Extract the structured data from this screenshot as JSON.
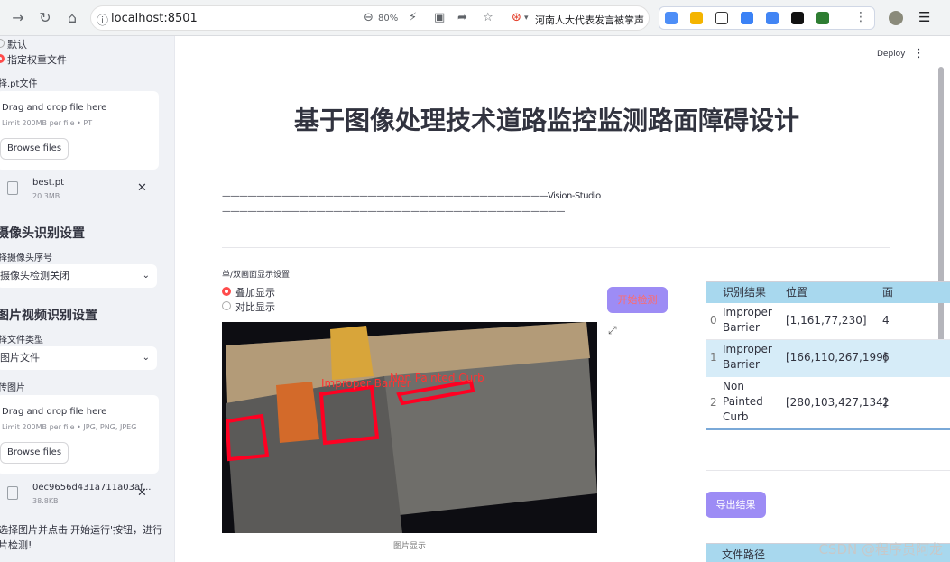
{
  "browser": {
    "url": "localhost:8501",
    "zoom": "80%",
    "news_text": "河南人大代表发言被掌声"
  },
  "header": {
    "deploy_label": "Deploy",
    "menu_icon": "kebab-icon"
  },
  "sidebar": {
    "radio_default": "默认",
    "radio_custom": "指定权重文件",
    "weight_label": "择.pt文件",
    "uploader1": {
      "drag_text": "Drag and drop file here",
      "limit_text": "Limit 200MB per file • PT",
      "browse_label": "Browse files"
    },
    "file1": {
      "name": "best.pt",
      "size": "20.3MB"
    },
    "camera_heading": "摄像头识别设置",
    "camera_select_label": "择摄像头序号",
    "camera_select_value": "摄像头检测关闭",
    "media_heading": "图片视频识别设置",
    "filetype_label": "择文件类型",
    "filetype_value": "图片文件",
    "upload_image_label": "传图片",
    "uploader2": {
      "drag_text": "Drag and drop file here",
      "limit_text": "Limit 200MB per file • JPG, PNG, JPEG",
      "browse_label": "Browse files"
    },
    "file2": {
      "name": "0ec9656d431a711a03af...",
      "size": "38.8KB"
    },
    "hint_line1": "选择图片并点击'开始运行'按钮，进行",
    "hint_line2": "片检测!"
  },
  "main": {
    "title": "基于图像处理技术道路监控监测路面障碍设计",
    "dash_line1": "——————————————————————————————————————Vision-Studio",
    "dash_line2": "————————————————————————————————————————",
    "display_label": "单/双画面显示设置",
    "radio_overlay": "叠加显示",
    "radio_compare": "对比显示",
    "start_button": "开始检测",
    "image_caption": "图片显示",
    "export_button": "导出结果",
    "table": {
      "headers": [
        "",
        "识别结果",
        "位置",
        "面"
      ],
      "rows": [
        {
          "index": "0",
          "result_line1": "Improper",
          "result_line2": "Barrier",
          "result_line3": "",
          "position": "[1,161,77,230]",
          "extra": "4"
        },
        {
          "index": "1",
          "result_line1": "Improper",
          "result_line2": "Barrier",
          "result_line3": "",
          "position": "[166,110,267,199]",
          "extra": "6"
        },
        {
          "index": "2",
          "result_line1": "Non",
          "result_line2": "Painted",
          "result_line3": "Curb",
          "position": "[280,103,427,134]",
          "extra": "2"
        }
      ]
    },
    "path_header": "文件路径",
    "detection_labels": [
      "Non Painted Curb",
      "Improper Barrier"
    ],
    "watermark": "CSDN @程序员阿龙"
  },
  "colors": {
    "accent": "#9d8cf5",
    "radio_active": "#ff4b4b",
    "table_header_bg": "#a8d8ee",
    "table_selected_bg": "#d6ecf8",
    "detection_box": "#ff0022"
  }
}
